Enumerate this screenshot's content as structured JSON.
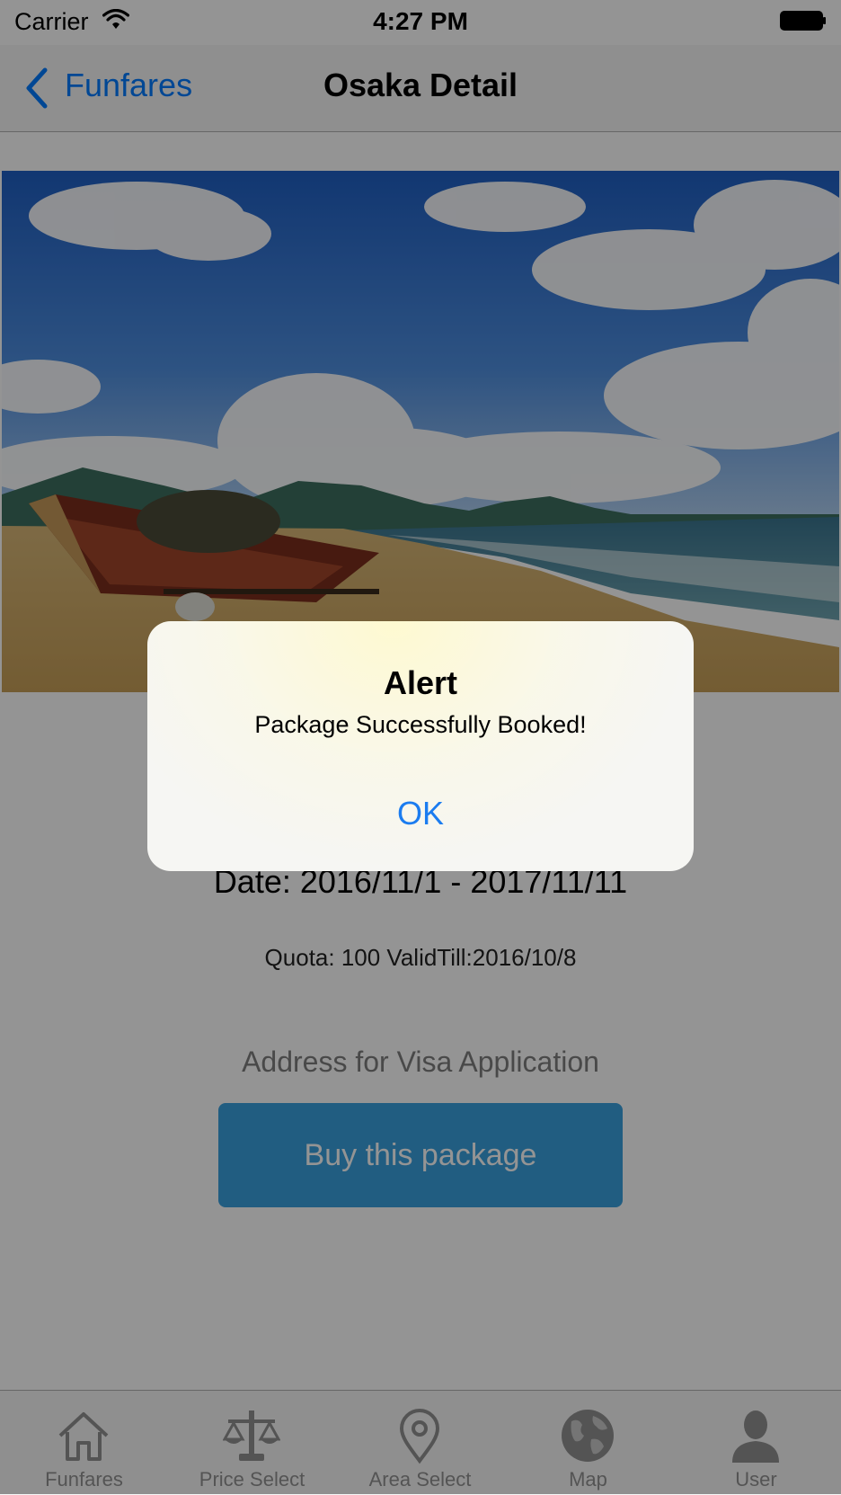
{
  "status_bar": {
    "carrier": "Carrier",
    "time": "4:27 PM"
  },
  "nav": {
    "back_label": "Funfares",
    "title": "Osaka Detail"
  },
  "hero_image": {
    "description_icon": "beach-photo"
  },
  "detail": {
    "date": "Date: 2016/11/1 - 2017/11/11",
    "quota": "Quota: 100 ValidTill:2016/10/8",
    "address_link": "Address for Visa Application",
    "buy_button": "Buy this package"
  },
  "alert": {
    "title": "Alert",
    "message": "Package Successfully Booked!",
    "ok": "OK"
  },
  "tab_bar": {
    "items": [
      {
        "label": "Funfares",
        "icon": "house-icon"
      },
      {
        "label": "Price Select",
        "icon": "scale-icon"
      },
      {
        "label": "Area Select",
        "icon": "location-pin-icon"
      },
      {
        "label": "Map",
        "icon": "globe-icon"
      },
      {
        "label": "User",
        "icon": "user-icon"
      }
    ]
  },
  "colors": {
    "accent": "#007aff",
    "button": "#3aa0de",
    "overlay": "rgba(0,0,0,0.42)"
  }
}
